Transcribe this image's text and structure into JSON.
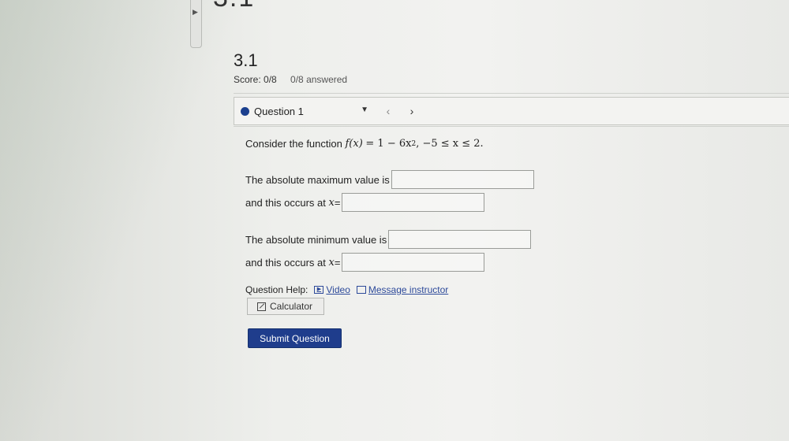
{
  "header": {
    "top_title_fragment": "3.1",
    "assignment_title": "3.1",
    "score": "Score: 0/8",
    "answered": "0/8 answered"
  },
  "question_nav": {
    "current": "Question 1",
    "prev_symbol": "‹",
    "next_symbol": "›"
  },
  "question": {
    "intro": "Consider the function",
    "function_lhs": "f(x)",
    "function_rhs": "= 1 − 6x",
    "exponent": "2",
    "domain": ",   −5 ≤ x ≤ 2.",
    "max_label": "The absolute maximum value is",
    "max_at_label": "and this occurs at",
    "min_label": "The absolute minimum value is",
    "min_at_label": "and this occurs at",
    "x_var": "x",
    "equals": " ="
  },
  "answers": {
    "max_value": "",
    "max_x": "",
    "min_value": "",
    "min_x": ""
  },
  "help": {
    "label": "Question Help:",
    "video": "Video",
    "message": "Message instructor",
    "calculator": "Calculator"
  },
  "actions": {
    "submit": "Submit Question"
  },
  "colors": {
    "accent": "#1f3d8c",
    "link": "#2d4a9a",
    "status_dot": "#1b3f8e"
  }
}
